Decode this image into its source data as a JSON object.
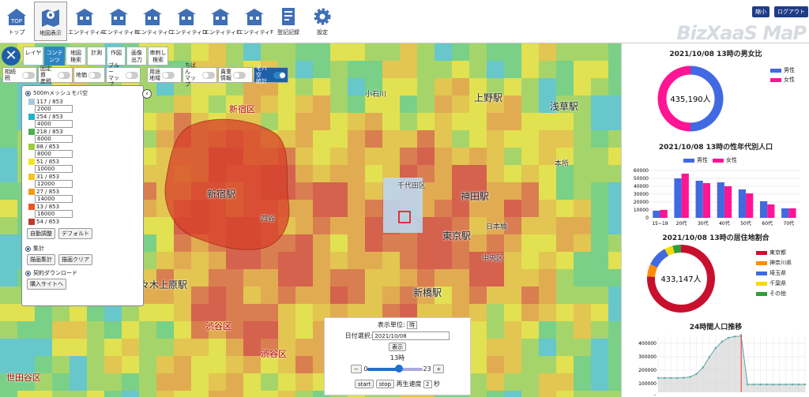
{
  "nav": [
    {
      "label": "トップ",
      "icon": "top-icon"
    },
    {
      "label": "地図表示",
      "icon": "map-icon"
    },
    {
      "label": "エンティティA",
      "icon": "building-icon"
    },
    {
      "label": "エンティティB",
      "icon": "building-icon"
    },
    {
      "label": "エンティティC",
      "icon": "building-icon"
    },
    {
      "label": "エンティティD",
      "icon": "building-icon"
    },
    {
      "label": "エンティティE",
      "icon": "building-icon"
    },
    {
      "label": "エンティティF",
      "icon": "building-icon"
    },
    {
      "label": "登記記録",
      "icon": "register-icon"
    },
    {
      "label": "設定",
      "icon": "gear-icon"
    }
  ],
  "top_top_label": "TOP",
  "header_buttons": {
    "shrink": "縮小",
    "logout": "ログアウト"
  },
  "brand": "BizXaaS MaP",
  "toolbar": {
    "close": "✕",
    "tabs": [
      "レイヤ",
      "コンテンツ",
      "地図\n検索",
      "計測",
      "作図",
      "画像\n出力",
      "串刺し\n検索"
    ]
  },
  "toggles": [
    "相続税",
    "固定資\n産税",
    "地価",
    "ブルー\nマップ",
    "用途\n地域",
    "ちばん\nマップ",
    "貴重\n情報",
    "モバ空\n統計"
  ],
  "panel": {
    "mesh_label": "500mメッシュモバ空",
    "legend": [
      {
        "text": "117 / 853",
        "value": "2000",
        "color": "#a6c9e2"
      },
      {
        "text": "254 / 853",
        "value": "4000",
        "color": "#20b3c8"
      },
      {
        "text": "218 / 853",
        "value": "6000",
        "color": "#4caf50"
      },
      {
        "text": "88 / 853",
        "value": "8000",
        "color": "#9bcc3a"
      },
      {
        "text": "51 / 853",
        "value": "10000",
        "color": "#f2e51d"
      },
      {
        "text": "31 / 853",
        "value": "12000",
        "color": "#f5c518"
      },
      {
        "text": "27 / 853",
        "value": "14000",
        "color": "#f39c12"
      },
      {
        "text": "13 / 853",
        "value": "16000",
        "color": "#e8581c"
      },
      {
        "text": "54 / 853",
        "value": "",
        "color": "#c0392b"
      }
    ],
    "auto_btn": "自動調整",
    "default_btn": "デフォルト",
    "tally_label": "集計",
    "draw_btn": "描画集計",
    "clear_btn": "描画クリア",
    "dl_label": "契約ダウンロード",
    "buy_btn": "購入サイトへ"
  },
  "map_labels": [
    {
      "t": "新宿区",
      "x": 290,
      "y": 130,
      "c": "red"
    },
    {
      "t": "新宿駅",
      "x": 262,
      "y": 237,
      "c": "big"
    },
    {
      "t": "上野駅",
      "x": 600,
      "y": 115,
      "c": "big"
    },
    {
      "t": "浅草駅",
      "x": 696,
      "y": 126,
      "c": "big"
    },
    {
      "t": "神田駅",
      "x": 583,
      "y": 240,
      "c": "big"
    },
    {
      "t": "東京駅",
      "x": 560,
      "y": 290,
      "c": "big"
    },
    {
      "t": "新橋駅",
      "x": 523,
      "y": 362,
      "c": "big"
    },
    {
      "t": "代々木上原駅",
      "x": 165,
      "y": 352,
      "c": "big"
    },
    {
      "t": "渋谷区",
      "x": 260,
      "y": 405,
      "c": "red"
    },
    {
      "t": "渋谷区",
      "x": 330,
      "y": 440,
      "c": "red"
    },
    {
      "t": "日本橋",
      "x": 615,
      "y": 280,
      "c": ""
    },
    {
      "t": "千代田区",
      "x": 503,
      "y": 228,
      "c": ""
    },
    {
      "t": "小石川",
      "x": 462,
      "y": 112,
      "c": ""
    },
    {
      "t": "四谷",
      "x": 330,
      "y": 270,
      "c": ""
    },
    {
      "t": "中央区",
      "x": 610,
      "y": 320,
      "c": ""
    },
    {
      "t": "本所",
      "x": 702,
      "y": 200,
      "c": ""
    },
    {
      "t": "世田谷区",
      "x": 8,
      "y": 470,
      "c": "red"
    }
  ],
  "time": {
    "unit_label": "表示単位:",
    "unit": "時",
    "date_label": "日付選択:",
    "date": "2021/10/08",
    "show_btn": "表示",
    "hour_label": "13時",
    "min": "0",
    "max": "23",
    "minus": "−",
    "plus": "+",
    "start": "start",
    "stop": "stop",
    "speed_label": "再生速度",
    "speed": "2",
    "speed_unit": "秒",
    "slider_fraction": 0.565
  },
  "charts": {
    "gender": {
      "title": "2021/10/08 13時の男女比",
      "center": "435,190人",
      "legend": [
        {
          "name": "男性",
          "color": "#4169e1"
        },
        {
          "name": "女性",
          "color": "#ff1493"
        }
      ],
      "male": 0.5,
      "female": 0.5
    },
    "age": {
      "title": "2021/10/08 13時の性年代別人口",
      "legend": [
        {
          "name": "男性",
          "color": "#4169e1"
        },
        {
          "name": "女性",
          "color": "#ff1493"
        }
      ],
      "categories": [
        "15~19",
        "20代",
        "30代",
        "40代",
        "50代",
        "60代",
        "70代"
      ],
      "male": [
        9000,
        50000,
        47000,
        45000,
        36000,
        21000,
        12000
      ],
      "female": [
        10000,
        56000,
        44000,
        40000,
        31000,
        17000,
        12000
      ],
      "yticks": [
        "60000",
        "50000",
        "40000",
        "30000",
        "20000",
        "10000",
        "0"
      ],
      "ymax": 60000
    },
    "residence": {
      "title": "2021/10/08 13時の居住地割合",
      "center": "433,147人",
      "legend": [
        {
          "name": "東京都",
          "color": "#c8102e"
        },
        {
          "name": "神奈川県",
          "color": "#ff8c00"
        },
        {
          "name": "埼玉県",
          "color": "#4169e1"
        },
        {
          "name": "千葉県",
          "color": "#f5d90a"
        },
        {
          "name": "その他",
          "color": "#2e9e3a"
        }
      ],
      "values": [
        0.76,
        0.06,
        0.1,
        0.04,
        0.04
      ]
    },
    "daily": {
      "title": "24時間人口推移",
      "yticks": [
        "400000",
        "300000",
        "200000",
        "100000",
        "0"
      ],
      "ymax": 450000,
      "values": [
        110000,
        110000,
        110000,
        110000,
        112000,
        118000,
        140000,
        190000,
        270000,
        340000,
        390000,
        420000,
        430000,
        433000,
        60000,
        60000,
        60000,
        60000,
        60000,
        60000,
        60000,
        60000,
        60000,
        60000
      ]
    }
  }
}
